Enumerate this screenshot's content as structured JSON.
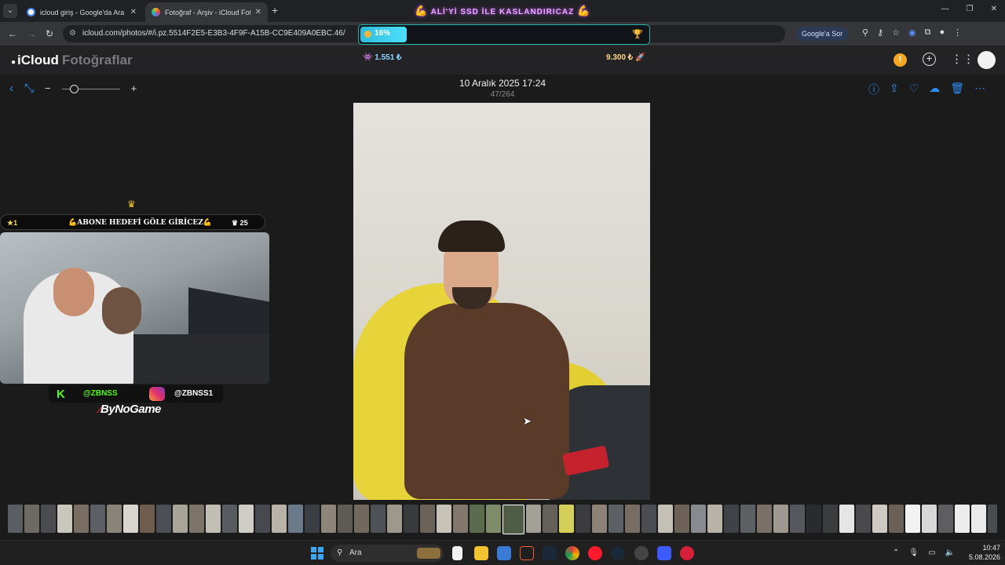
{
  "browser": {
    "tabs": [
      {
        "title": "icloud giriş - Google'da Ara",
        "favicon_color": "#4285f4"
      },
      {
        "title": "Fotoğraf - Arşiv - iCloud Fotoğ",
        "favicon_color": "#f5a623"
      }
    ],
    "url": "icloud.com/photos/#/i.pz.5514F2E5-E3B3-4F9F-A15B-CC9E409A0EBC.46/",
    "ask_google": "Google'a Sor"
  },
  "stream_overlay": {
    "banner": "ALİ'Yİ SSD İLE KASLANDIRICAZ",
    "goal_percent": "16%",
    "goal_fraction": 0.16,
    "stat_left": "1.551 ₺",
    "stat_right": "9.300 ₺",
    "sub_left": "1",
    "sub_center": "ABONE HEDEFİ GÖLE GİRİCEZ",
    "sub_right": "25",
    "kick_name": "@ZBNSS",
    "instagram_name": "@ZBNSS1",
    "sponsor": "ByNoGame"
  },
  "icloud": {
    "brand": "iCloud",
    "app_name": "Fotoğraflar",
    "photo_date": "10 Aralık 2025 17:24",
    "photo_count": "47/264"
  },
  "filmstrip": {
    "thumb_colors": [
      "#5a5e62",
      "#6d6a64",
      "#4a4c50",
      "#c9c6bd",
      "#7a6e62",
      "#5c6064",
      "#8a8478",
      "#d8d5cf",
      "#6e5c4c",
      "#4c4f54",
      "#a9a49a",
      "#7c7468",
      "#c2beb5",
      "#585b60",
      "#d0cdc6",
      "#46494e",
      "#b9b3a7",
      "#6a7a8a",
      "#3b3e42",
      "#8e857a",
      "#5e5a54",
      "#72695e",
      "#4e5156",
      "#9d978c",
      "#383a3d",
      "#6b6258",
      "#c7c2b8",
      "#82786c",
      "#5a6b4e",
      "#7e8c6a",
      "#4f5c46",
      "#a3a097",
      "#66605a",
      "#d4cf58",
      "#3a3c40",
      "#8c8276",
      "#5c5f63",
      "#776d62",
      "#4a4d52",
      "#c5c0b6",
      "#6c6258",
      "#878b8f",
      "#b8b2a8",
      "#3f4246",
      "#5d6062",
      "#7a7066",
      "#9e9890",
      "#54575b",
      "#2a2b2e",
      "#3b3c3e",
      "#e5e5e5",
      "#4a4a4c",
      "#cfcac1",
      "#6a6058",
      "#f2f2f2",
      "#d8d8d8",
      "#5e5e60",
      "#ededed",
      "#eaeaea",
      "#4a4d50",
      "#dcdcdc",
      "#8d8478",
      "#7a8a96",
      "#b5b0a6",
      "#5d6064",
      "#c8c2b8",
      "#4e5256",
      "#6c665e",
      "#3d4044",
      "#8a7e70",
      "#51545a",
      "#a59f94"
    ],
    "selected_index": 30
  },
  "taskbar": {
    "search_label": "Ara",
    "time": "10:47",
    "date": "5.08.2026"
  }
}
